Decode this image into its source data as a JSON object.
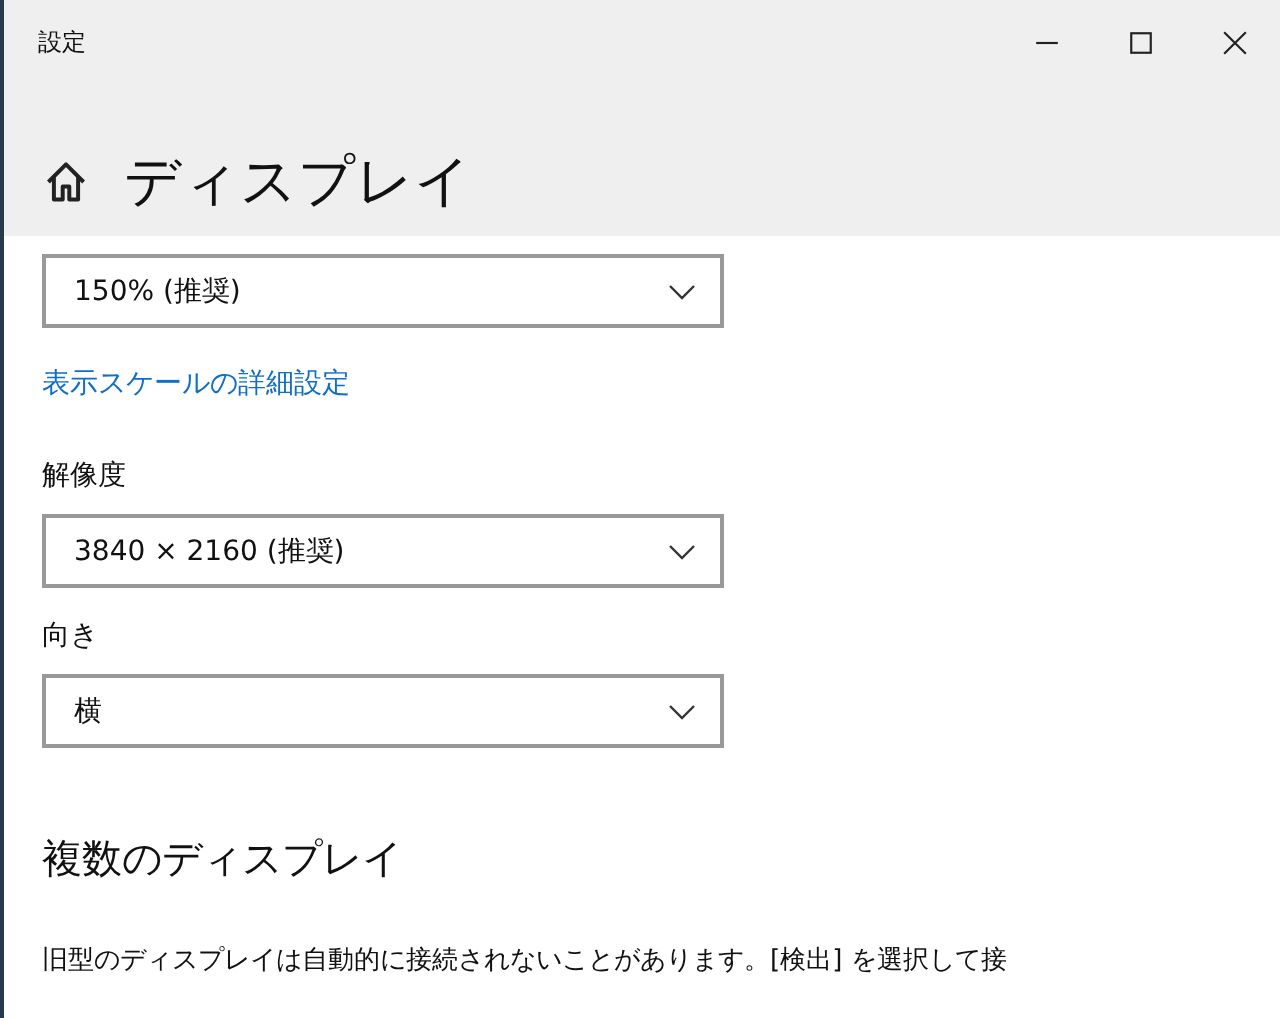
{
  "window": {
    "title": "設定"
  },
  "page": {
    "title": "ディスプレイ"
  },
  "scale": {
    "value": "150% (推奨)",
    "link": "表示スケールの詳細設定"
  },
  "resolution": {
    "label": "解像度",
    "value": "3840 × 2160 (推奨)"
  },
  "orientation": {
    "label": "向き",
    "value": "横"
  },
  "multiple": {
    "heading": "複数のディスプレイ",
    "text": "旧型のディスプレイは自動的に接続されないことがあります。[検出] を選択して接"
  }
}
